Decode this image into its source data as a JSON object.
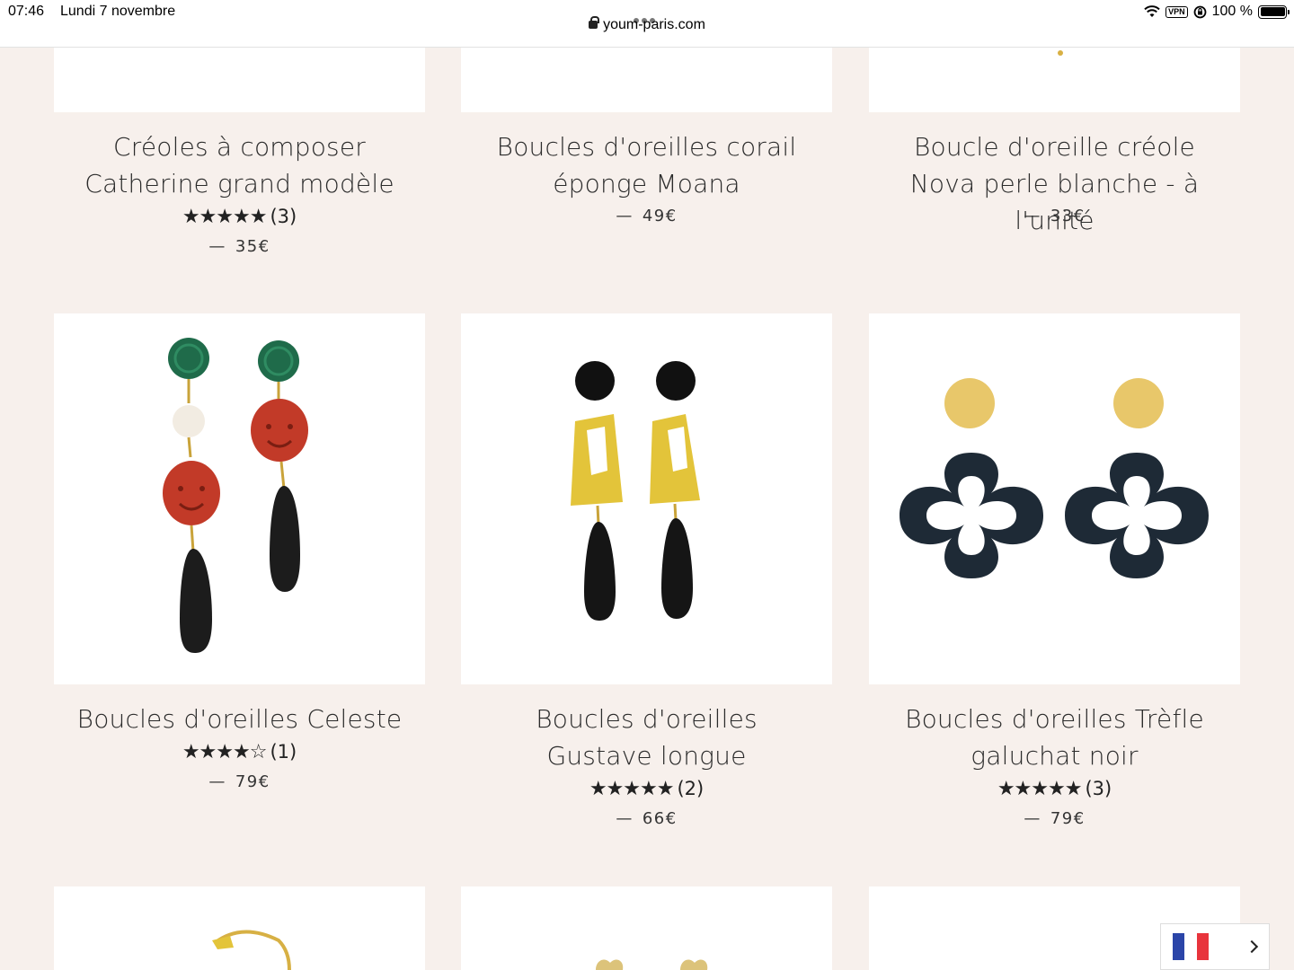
{
  "status_bar": {
    "time": "07:46",
    "date": "Lundi 7 novembre",
    "url": "youm-paris.com",
    "battery": "100 %"
  },
  "products": [
    {
      "name": "Créoles à composer Catherine grand modèle",
      "stars": "★★★★★",
      "reviews": "(3)",
      "price": "35€"
    },
    {
      "name": "Boucles d'oreilles corail éponge Moana",
      "stars": "",
      "reviews": "",
      "price": "49€"
    },
    {
      "name": "Boucle d'oreille créole Nova perle blanche - à l'unité",
      "stars": "",
      "reviews": "",
      "price": "33€"
    },
    {
      "name": "Boucles d'oreilles Celeste",
      "stars": "★★★★☆",
      "reviews": "(1)",
      "price": "79€"
    },
    {
      "name": "Boucles d'oreilles Gustave longue",
      "stars": "★★★★★",
      "reviews": "(2)",
      "price": "66€"
    },
    {
      "name": "Boucles d'oreilles Trèfle galuchat noir",
      "stars": "★★★★★",
      "reviews": "(3)",
      "price": "79€"
    }
  ],
  "price_dash": "—",
  "language": {
    "flag": "flag-fr-icon",
    "colors": [
      "#2b45a8",
      "#ffffff",
      "#e8343c"
    ]
  }
}
